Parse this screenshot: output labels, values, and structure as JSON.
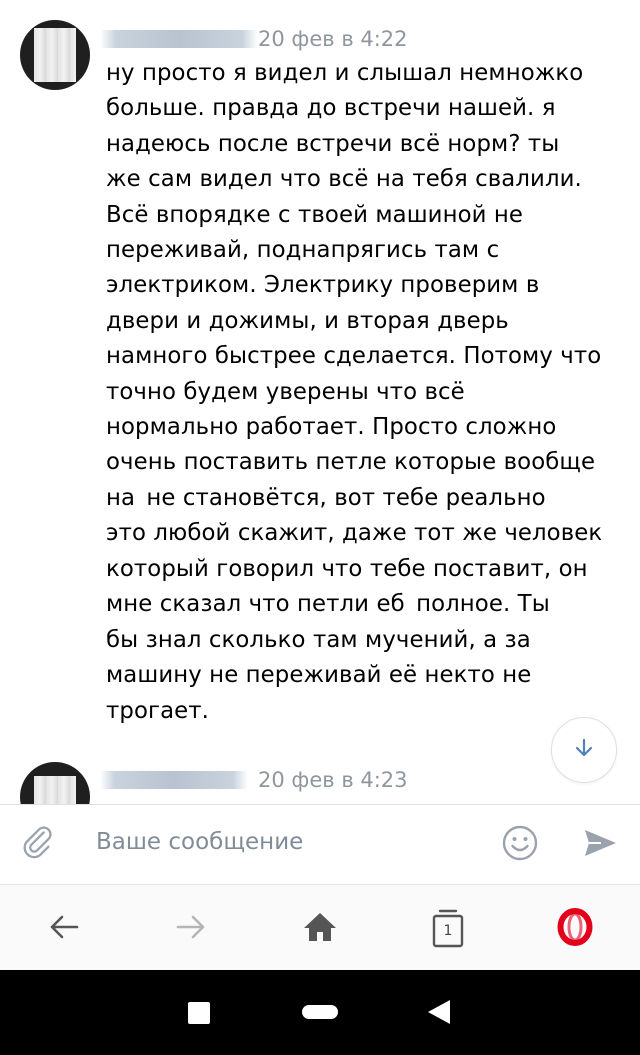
{
  "messages": [
    {
      "time": "20 фев в 4:22",
      "lines": [
        "ну просто я видел и слышал немножко",
        "больше. правда до встречи нашей. я",
        "надеюсь после встречи всё норм? ты",
        "же сам видел что всё на тебя свалили.",
        "Всё впорядке с твоей машиной не",
        "переживай, поднапрягись там с",
        "электриком. Электрику проверим в",
        "двери и дожимы, и вторая дверь",
        "намного быстрее сделается. Потому что",
        "точно будем уверены что всё",
        "нормально работает. Просто сложно",
        "очень поставить петле которые вообще",
        "на",
        " не становётся, вот тебе реально",
        "это любой скажит, даже тот же человек",
        "который говорил что тебе поставит, он",
        "мне сказал что петли еб",
        " полное. Ты",
        "бы знал сколько там мучений, а за",
        "машину не переживай её некто не",
        "трогает."
      ]
    },
    {
      "time": "20 фев в 4:23"
    }
  ],
  "compose": {
    "placeholder": "Ваше сообщение"
  },
  "browser": {
    "tab_count": "1"
  },
  "colors": {
    "time": "#8f969e",
    "placeholder": "#818c99",
    "accent": "#5181b8",
    "opera_red": "#e3001b"
  },
  "icons": {
    "attach": "paperclip-icon",
    "emoji": "smile-icon",
    "send": "send-icon",
    "scroll_down": "arrow-down-icon",
    "back": "arrow-left-icon",
    "forward": "arrow-right-icon",
    "home": "home-icon",
    "tabs": "tabs-icon",
    "opera": "opera-logo-icon"
  }
}
